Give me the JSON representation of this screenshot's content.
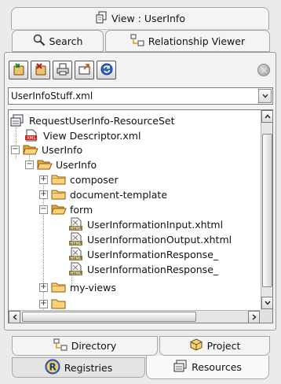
{
  "top_tabs": {
    "view": "View : UserInfo",
    "search": "Search",
    "relationship": "Relationship Viewer"
  },
  "toolbar": {
    "buttons": [
      "new-resource-icon",
      "delete-resource-icon",
      "print-icon",
      "export-icon",
      "refresh-icon"
    ],
    "stop": "stop-icon"
  },
  "resource_set_select": {
    "value": "UserInfoStuff.xml"
  },
  "tree": {
    "items": [
      {
        "label": "RequestUserInfo-ResourceSet",
        "icon": "resource-set-icon",
        "expander": ""
      },
      {
        "label": "View Descriptor.xml",
        "icon": "xml-file-icon",
        "expander": ""
      },
      {
        "label": "UserInfo",
        "icon": "folder-open-icon",
        "expander": "−"
      },
      {
        "label": "UserInfo",
        "icon": "folder-open-icon",
        "expander": "−"
      },
      {
        "label": "composer",
        "icon": "folder-icon",
        "expander": "+"
      },
      {
        "label": "document-template",
        "icon": "folder-icon",
        "expander": "+"
      },
      {
        "label": "form",
        "icon": "folder-open-icon",
        "expander": "−"
      },
      {
        "label": "UserInformationInput.xhtml",
        "icon": "xhtml-file-icon",
        "expander": ""
      },
      {
        "label": "UserInformationOutput.xhtml",
        "icon": "xhtml-file-icon",
        "expander": ""
      },
      {
        "label": "UserInformationResponse_",
        "icon": "xhtml-file-icon",
        "expander": ""
      },
      {
        "label": "UserInformationResponse_",
        "icon": "xhtml-file-icon",
        "expander": ""
      },
      {
        "label": "my-views",
        "icon": "folder-icon",
        "expander": "+"
      }
    ]
  },
  "bottom_tabs": {
    "directory": "Directory",
    "project": "Project",
    "registries": "Registries",
    "resources": "Resources"
  },
  "colors": {
    "folder": "#f6c25a",
    "xhtml_badge": "#8a7a3a",
    "registry_ring": "#2b59b8"
  }
}
